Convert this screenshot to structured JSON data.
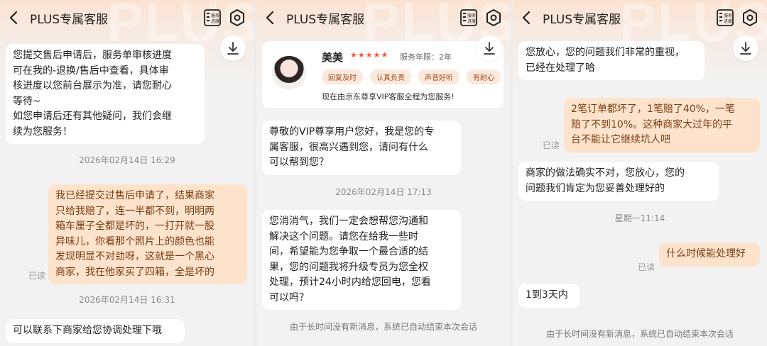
{
  "app": {
    "title": "PLUS专属客服",
    "watermark": "PLUS",
    "progress_label_line1": "服务",
    "progress_label_line2": "进度"
  },
  "colors": {
    "accent": "#f25a3a",
    "user_bubble": "#fde3cc",
    "user_text": "#7a3d12",
    "tag_bg": "#fbe9dd"
  },
  "panel1": {
    "msg1": [
      "您提交售后申请后，服务单审核进度",
      "可在我的-退换/售后中查看，具体审",
      "核进度以您前台展示为准，请您耐心",
      "等待~",
      "如您申请后还有其他疑问，我们会继",
      "续为您服务！"
    ],
    "ts1": "2026年02月14日 16:29",
    "msg2": [
      "我已经提交过售后申请了，结果商家",
      "只给我赔了，连一半都不到，明明两",
      "箱车厘子全都是坏的，一打开就一股",
      "异味儿，你看那个照片上的颜色也能",
      "发现明显不对劲呀，这就是一个黑心",
      "商家，我在他家买了四箱，全是坏的"
    ],
    "read1": "已读",
    "ts2": "2026年02月14日 16:31",
    "msg3": "可以联系下商家给您协调处理下哦"
  },
  "panel2": {
    "agent": {
      "name": "美美",
      "stars": "★★★★★",
      "tenure": "服务年限：2年",
      "tags": [
        "回复及时",
        "认真负责",
        "声音好听",
        "有耐心"
      ],
      "note": "现在由京东尊享VIP客服全程为您服务!"
    },
    "msg1": [
      "尊敬的VIP尊享用户您好，我是您的专",
      "属客服，很高兴遇到您，请问有什么",
      "可以帮到您？"
    ],
    "ts1": "2026年02月14日 17:13",
    "msg2": [
      "您消消气，我们一定会想帮您沟通和",
      "解决这个问题。请您在给我一些时",
      "间，希望能为您争取一个最合适的结",
      "果，您的问题我将升级专员为您全权",
      "处理，预计24小时内给您回电，您看",
      "可以吗？"
    ],
    "sys_note": "由于长时间没有新消息，系统已自动结束本次会话"
  },
  "panel3": {
    "msg1": [
      "您放心，您的问题我们非常的重视，",
      "已经在处理了哈"
    ],
    "msg2": [
      "2笔订单都坏了，1笔赔了40%，一笔",
      "赔了不到10%。这种商家大过年的平",
      "台不能让它继续坑人吧"
    ],
    "read1": "已读",
    "msg3": [
      "商家的做法确实不对，您放心，您的",
      "问题我们肯定为您妥善处理好的"
    ],
    "ts1": "星期一11:14",
    "msg4": "什么时候能处理好",
    "read2": "已读",
    "msg5": "1到3天内",
    "sys_note": "由于长时间没有新消息，系统已自动结束本次会话"
  }
}
